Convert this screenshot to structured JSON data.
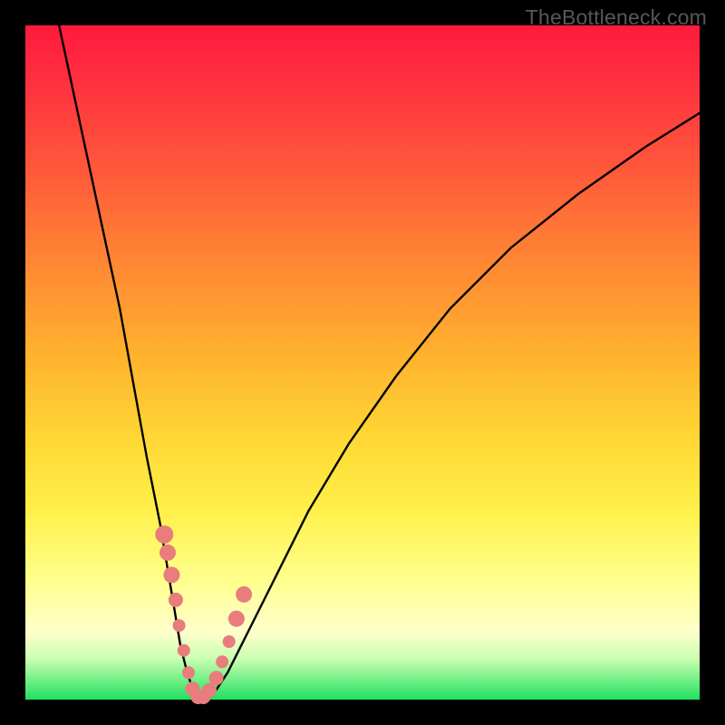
{
  "watermark": "TheBottleneck.com",
  "chart_data": {
    "type": "line",
    "title": "",
    "xlabel": "",
    "ylabel": "",
    "xlim": [
      0,
      100
    ],
    "ylim": [
      0,
      100
    ],
    "grid": false,
    "legend": false,
    "series": [
      {
        "name": "bottleneck-curve",
        "x": [
          5,
          8,
          11,
          14,
          16,
          18,
          20,
          21,
          22,
          23,
          24,
          25,
          26,
          28,
          30,
          33,
          37,
          42,
          48,
          55,
          63,
          72,
          82,
          92,
          100
        ],
        "y": [
          100,
          86,
          72,
          58,
          47,
          36,
          26,
          20,
          14,
          8,
          4,
          1,
          0,
          1,
          4,
          10,
          18,
          28,
          38,
          48,
          58,
          67,
          75,
          82,
          87
        ]
      }
    ],
    "points": {
      "name": "highlight-dots",
      "x": [
        20.6,
        21.1,
        21.7,
        22.3,
        22.8,
        23.5,
        24.2,
        24.8,
        25.6,
        26.4,
        27.3,
        28.3,
        29.2,
        30.2,
        31.3,
        32.4
      ],
      "y": [
        24.5,
        21.8,
        18.5,
        14.8,
        11.0,
        7.3,
        4.0,
        1.6,
        0.4,
        0.4,
        1.4,
        3.2,
        5.6,
        8.6,
        12.0,
        15.6
      ],
      "approx_radius_px": [
        10,
        9,
        9,
        8,
        7,
        7,
        7,
        8,
        8,
        8,
        8,
        8,
        7,
        7,
        9,
        9
      ]
    }
  },
  "colors": {
    "dot_fill": "#e97c7c",
    "curve_stroke": "#000000",
    "frame_bg": "#000000"
  }
}
